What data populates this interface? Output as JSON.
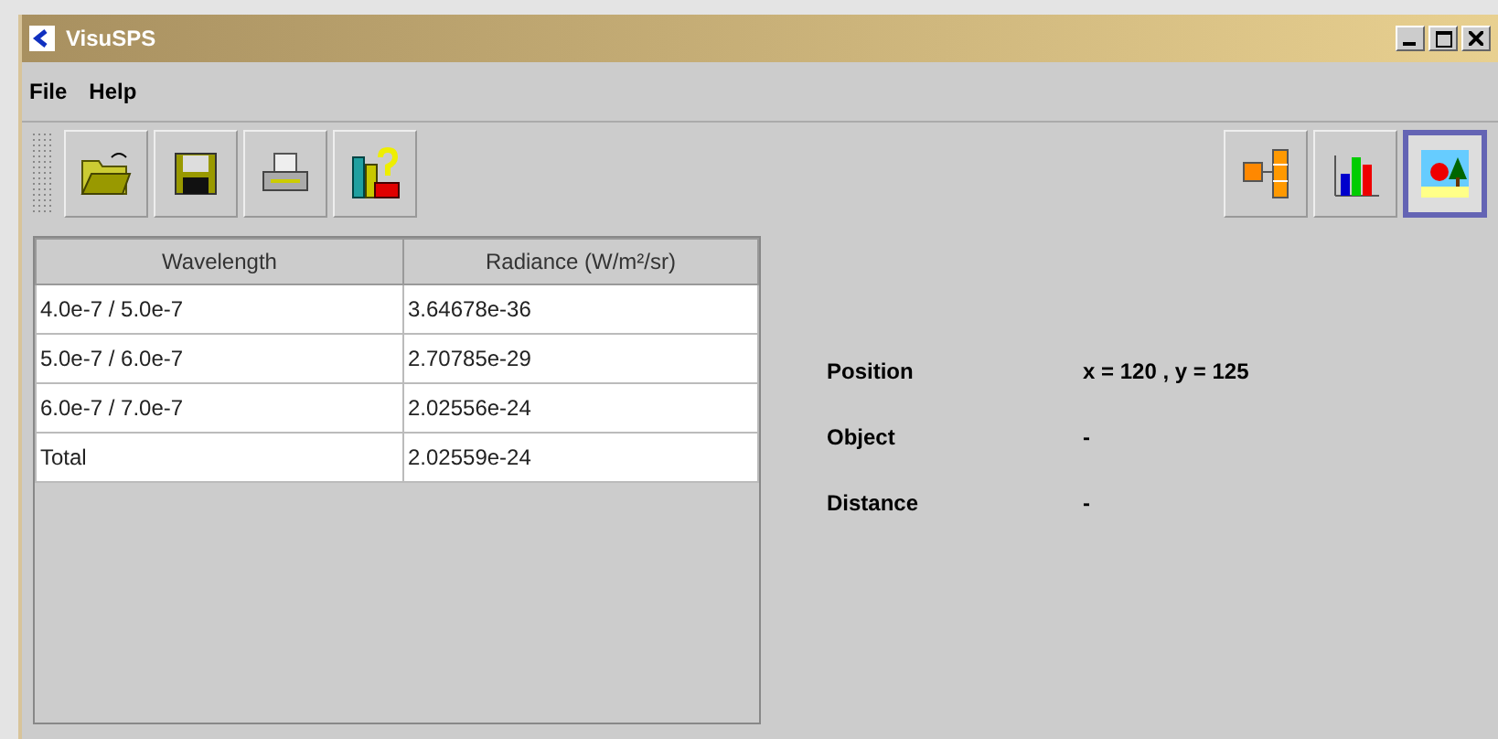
{
  "window": {
    "title": "VisuSPS"
  },
  "menu": [
    "File",
    "Help"
  ],
  "views": [
    {
      "selected": false
    },
    {
      "selected": false
    },
    {
      "selected": true
    }
  ],
  "table": {
    "columns": [
      "Wavelength",
      "Radiance (W/m²/sr)"
    ],
    "rows": [
      [
        "4.0e-7 / 5.0e-7",
        "3.64678e-36"
      ],
      [
        "5.0e-7 / 6.0e-7",
        "2.70785e-29"
      ],
      [
        "6.0e-7 / 7.0e-7",
        "2.02556e-24"
      ],
      [
        "Total",
        "2.02559e-24"
      ]
    ]
  },
  "info": [
    {
      "label": "Position",
      "value": "x = 120 , y = 125"
    },
    {
      "label": "Object",
      "value": "-"
    },
    {
      "label": "Distance",
      "value": "-"
    }
  ]
}
